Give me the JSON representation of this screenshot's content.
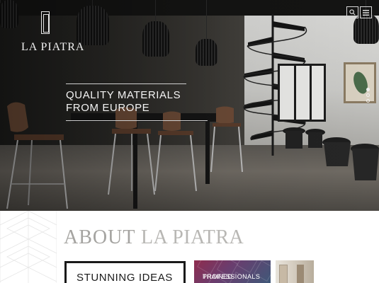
{
  "header": {
    "logo_text": "LA PIATRA",
    "search_icon": "search-icon",
    "menu_icon": "menu-icon"
  },
  "hero": {
    "tagline_line1": "QUALITY MATERIALS",
    "tagline_line2": "FROM EUROPE",
    "slides": {
      "count": 3,
      "active_index": 0
    }
  },
  "about": {
    "title_bold": "ABOUT",
    "title_light": "LA PIATRA",
    "cards": [
      {
        "label": "STUNNING IDEAS"
      },
      {
        "label_line1": "TRAINED",
        "label_line2": "PROFESSIONALS"
      },
      {
        "label": ""
      }
    ]
  },
  "colors": {
    "hero_dark": "#2b2a27",
    "text_light": "#f4f4f4",
    "about_title": "#a9a8a6",
    "card_border": "#1a1a1a",
    "card2_accent": "#8f2c4e"
  }
}
